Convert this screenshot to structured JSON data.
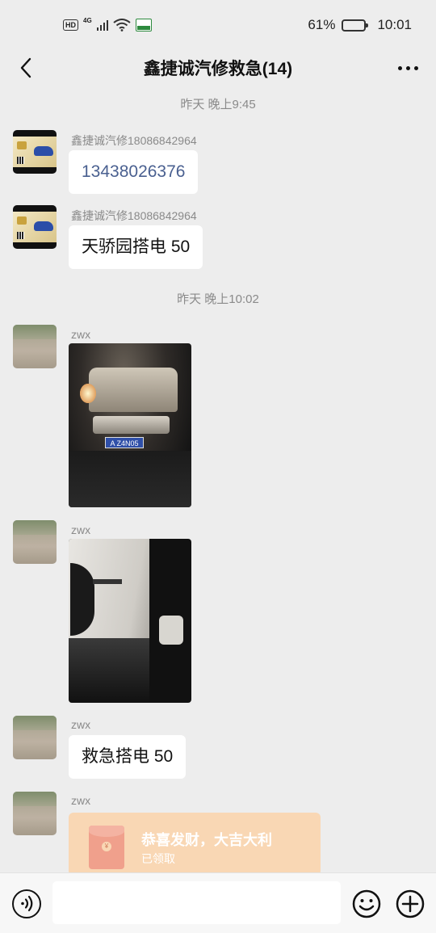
{
  "status_bar": {
    "hd": "HD",
    "network": "4G",
    "battery_percent": "61%",
    "battery_level": 0.61,
    "time": "10:01"
  },
  "header": {
    "title": "鑫捷诚汽修救急(14)",
    "back_icon": "chevron-left-icon",
    "more_icon": "more-dots-icon"
  },
  "timestamps": [
    "昨天 晚上9:45",
    "昨天 晚上10:02"
  ],
  "messages": [
    {
      "sender": "鑫捷诚汽修18086842964",
      "type": "text",
      "text": "13438026376",
      "is_link": true
    },
    {
      "sender": "鑫捷诚汽修18086842964",
      "type": "text",
      "text": "天骄园搭电 50"
    },
    {
      "sender": "zwx",
      "type": "image",
      "description_icon": "car-photo",
      "plate": "A Z4N05"
    },
    {
      "sender": "zwx",
      "type": "image",
      "description_icon": "door-photo"
    },
    {
      "sender": "zwx",
      "type": "text",
      "text": "救急搭电 50"
    },
    {
      "sender": "zwx",
      "type": "red_packet",
      "title": "恭喜发财，大吉大利",
      "status": "已领取",
      "coin": "¥"
    }
  ],
  "input_bar": {
    "voice_icon": "voice-icon",
    "emoji_icon": "emoji-icon",
    "plus_icon": "plus-icon",
    "input_value": ""
  },
  "colors": {
    "background": "#ededed",
    "bubble": "#ffffff",
    "red_packet": "#f9d7b4",
    "link_text": "#4a6090"
  }
}
